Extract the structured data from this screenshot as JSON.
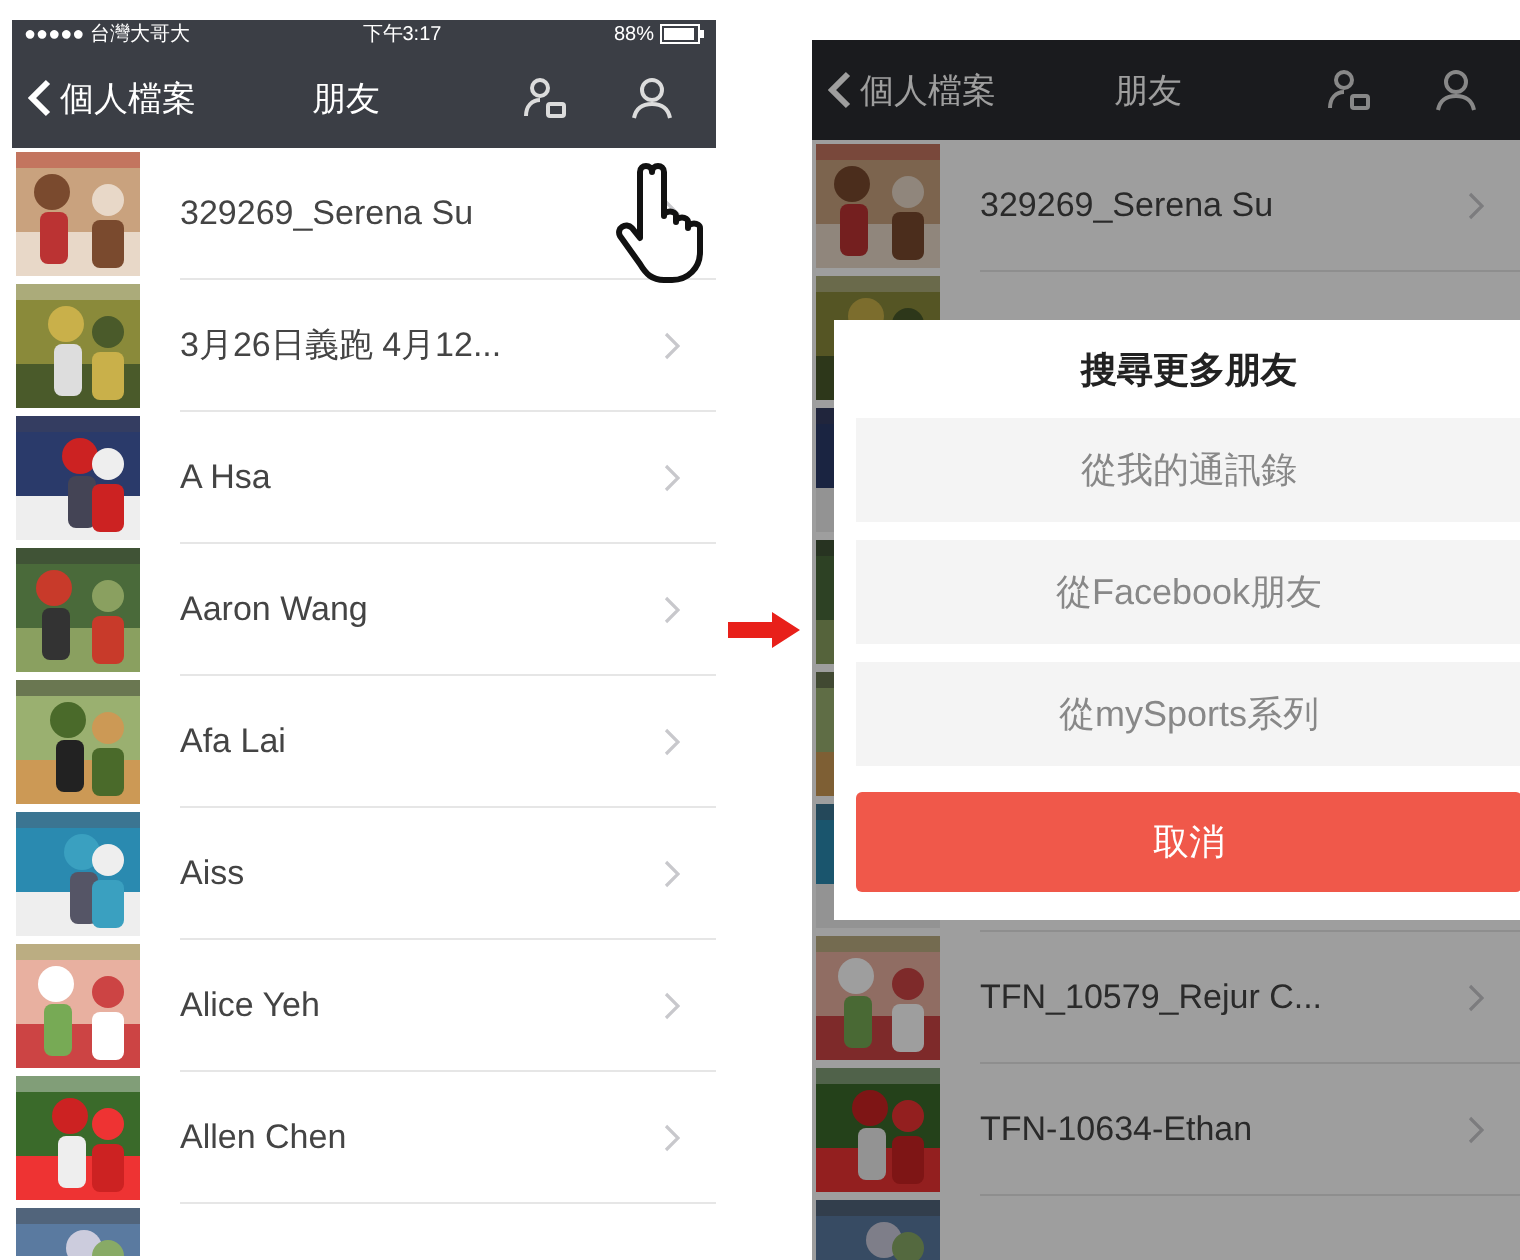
{
  "left_screen": {
    "status_bar": {
      "carrier": "●●●●● 台灣大哥大",
      "time": "下午3:17",
      "battery": "88%"
    },
    "nav_bar": {
      "back": "個人檔案",
      "title": "朋友"
    },
    "friends": [
      {
        "name": "329269_Serena Su"
      },
      {
        "name": "3月26日義跑 4月12..."
      },
      {
        "name": "A Hsa"
      },
      {
        "name": "Aaron Wang"
      },
      {
        "name": "Afa Lai"
      },
      {
        "name": "Aiss"
      },
      {
        "name": "Alice Yeh"
      },
      {
        "name": "Allen Chen"
      }
    ]
  },
  "right_screen": {
    "nav_bar": {
      "back": "個人檔案",
      "title": "朋友"
    },
    "friends_above_dialog": [
      {
        "name": "329269_Serena Su"
      }
    ],
    "friends_below_dialog": [
      {
        "name": "TFN_10579_Rejur C..."
      },
      {
        "name": "TFN-10634-Ethan"
      }
    ],
    "dialog": {
      "title": "搜尋更多朋友",
      "options": [
        "從我的通訊錄",
        "從Facebook朋友",
        "從mySports系列"
      ],
      "cancel": "取消"
    }
  }
}
